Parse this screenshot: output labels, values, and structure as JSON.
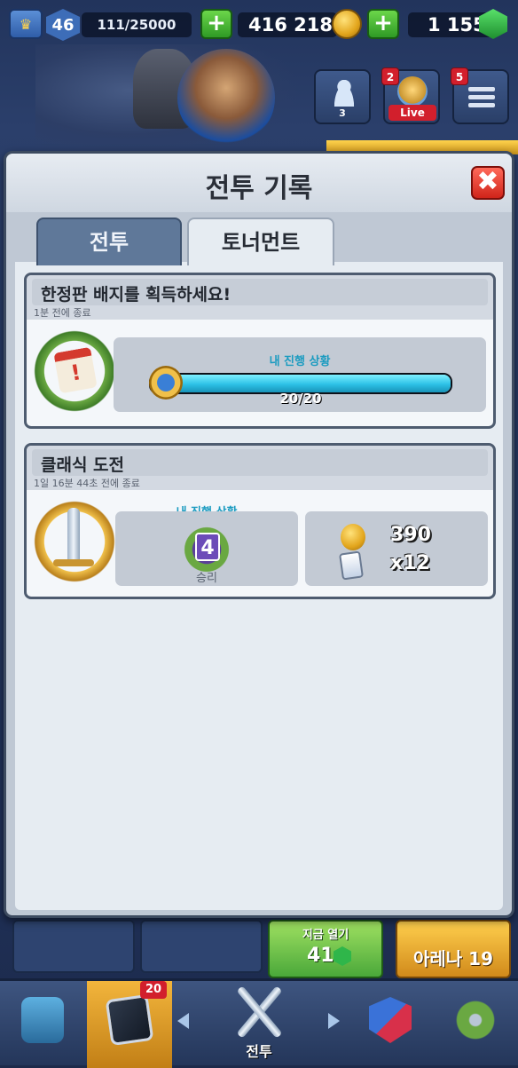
{
  "top_bar": {
    "level": "46",
    "xp": "111/25000",
    "gold": "416 218",
    "gems": "1 155"
  },
  "side": {
    "friends_count": "3",
    "live_notif": "2",
    "live_label": "Live",
    "menu_notif": "5"
  },
  "modal": {
    "title": "전투 기록",
    "close_label": "✖",
    "tabs": [
      {
        "label": "전투",
        "active": false
      },
      {
        "label": "토너먼트",
        "active": true
      }
    ]
  },
  "cards": [
    {
      "title": "한정판 배지를 획득하세요!",
      "ended": "1분 전에 종료",
      "progress_label": "내 진행 상황",
      "progress_text": "20/20",
      "progress_fraction": 1.0,
      "calendar_glyph": "!"
    },
    {
      "title": "클래식 도전",
      "ended": "1일 16분 44초 전에 종료",
      "progress_label": "내 진행 상황",
      "wins": "4",
      "wins_label": "승리",
      "reward_gold": "390",
      "reward_cards": "x12"
    }
  ],
  "bottom_slots": {
    "free_label": "지금 열기",
    "free_amount": "41",
    "arena_label": "아레나 19"
  },
  "bottom_nav": {
    "cards_badge": "20",
    "battle_label": "전투"
  },
  "colors": {
    "accent_cyan": "#2cc1e6",
    "close_red": "#d0241a",
    "plus_green": "#2f9a25",
    "nav_active": "#f2b53c"
  }
}
